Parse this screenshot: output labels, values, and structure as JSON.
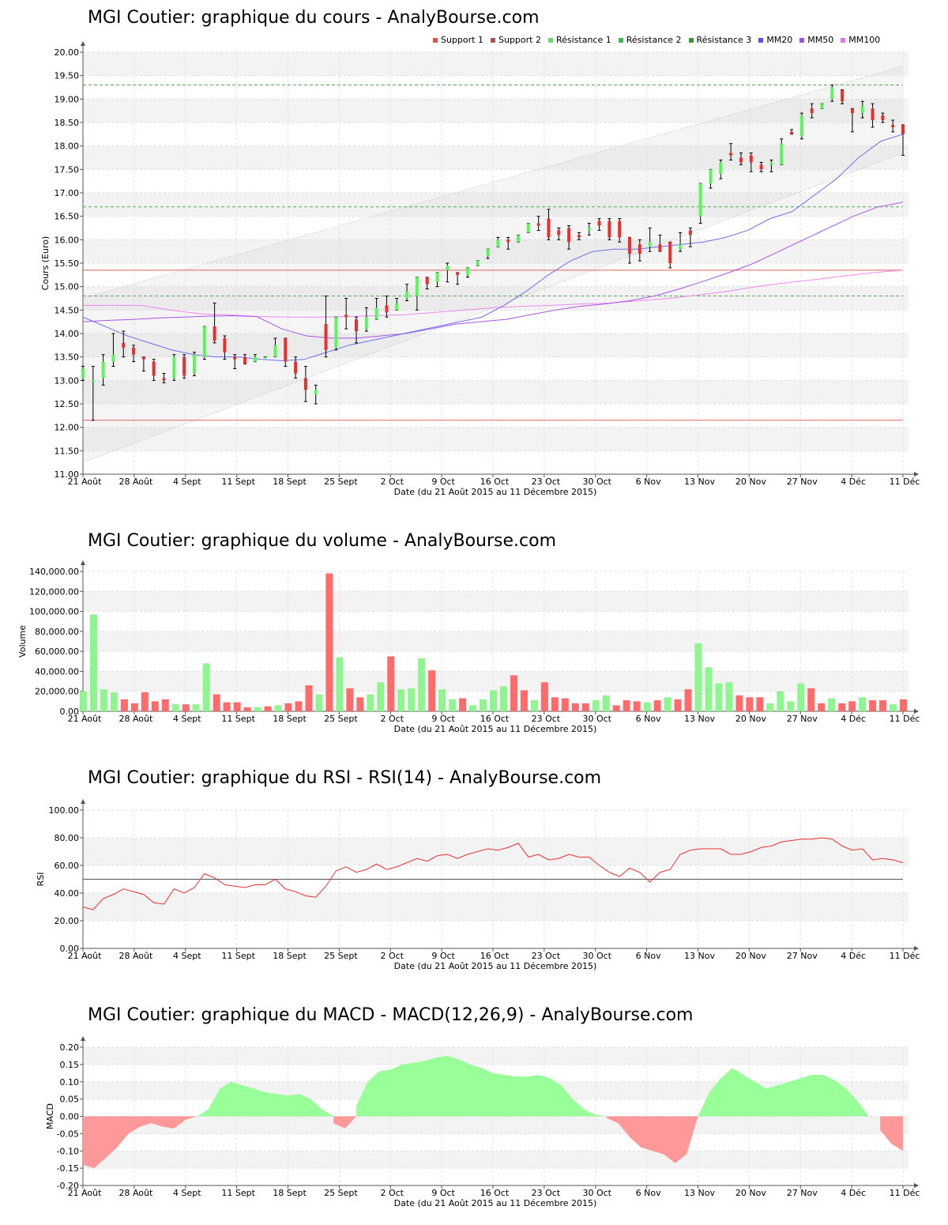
{
  "x_axis": {
    "ticks": [
      "21 Août",
      "28 Août",
      "4 Sept",
      "11 Sept",
      "18 Sept",
      "25 Sept",
      "2 Oct",
      "9 Oct",
      "16 Oct",
      "23 Oct",
      "30 Oct",
      "6 Nov",
      "13 Nov",
      "20 Nov",
      "27 Nov",
      "4 Déc",
      "11 Déc"
    ],
    "title": "Date (du 21 Août 2015 au 11 Décembre 2015)"
  },
  "colors": {
    "up": "#5df55d",
    "down": "#e8312f",
    "vol_up": "#8ff58f",
    "vol_down": "#ff6a6a",
    "mm20": "#6f6fef",
    "mm50": "#a855e8",
    "mm100": "#ee88ee",
    "support": "#e06060",
    "resistance": "#55aa55",
    "rsi": "#e83030",
    "macd_pos": "#99ff99",
    "macd_neg": "#ff9999"
  },
  "price_panel": {
    "title": "MGI Coutier: graphique du cours - AnalyBourse.com",
    "legend": [
      {
        "label": "Support 1",
        "color": "#e05050"
      },
      {
        "label": "Support 2",
        "color": "#b05050"
      },
      {
        "label": "Résistance 1",
        "color": "#66dd66"
      },
      {
        "label": "Résistance 2",
        "color": "#44bb44"
      },
      {
        "label": "Résistance 3",
        "color": "#339933"
      },
      {
        "label": "MM20",
        "color": "#5555ee"
      },
      {
        "label": "MM50",
        "color": "#9955dd"
      },
      {
        "label": "MM100",
        "color": "#dd77dd"
      }
    ],
    "chart_data": {
      "type": "candlestick",
      "title": "MGI Coutier: graphique du cours - AnalyBourse.com",
      "ylabel": "Cours (Euro)",
      "xlabel": "Date (du 21 Août 2015 au 11 Décembre 2015)",
      "ylim": [
        11.0,
        20.0
      ],
      "yticks": [
        "11.00",
        "11.50",
        "12.00",
        "12.50",
        "13.00",
        "13.50",
        "14.00",
        "14.50",
        "15.00",
        "15.50",
        "16.00",
        "16.50",
        "17.00",
        "17.50",
        "18.00",
        "18.50",
        "19.00",
        "19.50",
        "20.00"
      ],
      "candles": [
        [
          13.05,
          13.25,
          13.0,
          13.3
        ],
        [
          13.0,
          13.0,
          12.15,
          13.3
        ],
        [
          13.05,
          13.4,
          12.9,
          13.55
        ],
        [
          13.4,
          13.55,
          13.3,
          14.0
        ],
        [
          13.8,
          13.7,
          13.5,
          14.05
        ],
        [
          13.7,
          13.55,
          13.4,
          13.75
        ],
        [
          13.5,
          13.45,
          13.2,
          13.5
        ],
        [
          13.4,
          13.1,
          13.0,
          13.45
        ],
        [
          13.05,
          13.0,
          12.95,
          13.15
        ],
        [
          13.05,
          13.5,
          13.0,
          13.55
        ],
        [
          13.5,
          13.1,
          13.05,
          13.55
        ],
        [
          13.15,
          13.55,
          13.1,
          13.6
        ],
        [
          13.5,
          14.15,
          13.45,
          14.15
        ],
        [
          14.15,
          13.85,
          13.8,
          14.65
        ],
        [
          13.9,
          13.6,
          13.45,
          13.95
        ],
        [
          13.5,
          13.45,
          13.25,
          13.55
        ],
        [
          13.5,
          13.35,
          13.35,
          13.55
        ],
        [
          13.4,
          13.5,
          13.4,
          13.55
        ],
        [
          13.5,
          13.5,
          13.5,
          13.5
        ],
        [
          13.5,
          13.75,
          13.5,
          13.9
        ],
        [
          13.9,
          13.4,
          13.3,
          13.9
        ],
        [
          13.4,
          13.15,
          13.05,
          13.5
        ],
        [
          13.05,
          12.8,
          12.55,
          13.3
        ],
        [
          12.7,
          12.8,
          12.5,
          12.9
        ],
        [
          14.2,
          13.65,
          13.5,
          14.8
        ],
        [
          13.7,
          14.35,
          13.65,
          14.35
        ],
        [
          14.4,
          14.35,
          14.1,
          14.75
        ],
        [
          14.3,
          14.05,
          13.8,
          14.35
        ],
        [
          14.1,
          14.35,
          14.05,
          14.55
        ],
        [
          14.3,
          14.55,
          14.3,
          14.75
        ],
        [
          14.6,
          14.45,
          14.35,
          14.8
        ],
        [
          14.5,
          14.65,
          14.5,
          14.75
        ],
        [
          14.75,
          14.9,
          14.7,
          15.05
        ],
        [
          14.8,
          15.2,
          14.5,
          15.2
        ],
        [
          15.2,
          15.05,
          14.95,
          15.2
        ],
        [
          15.1,
          15.3,
          15.0,
          15.3
        ],
        [
          15.35,
          15.45,
          15.1,
          15.5
        ],
        [
          15.3,
          15.25,
          15.05,
          15.3
        ],
        [
          15.25,
          15.4,
          15.2,
          15.4
        ],
        [
          15.45,
          15.55,
          15.45,
          15.55
        ],
        [
          15.65,
          15.8,
          15.6,
          15.8
        ],
        [
          15.85,
          16.0,
          15.85,
          16.05
        ],
        [
          16.0,
          15.95,
          15.8,
          16.05
        ],
        [
          15.95,
          16.1,
          15.95,
          16.1
        ],
        [
          16.15,
          16.35,
          16.15,
          16.35
        ],
        [
          16.35,
          16.3,
          16.2,
          16.5
        ],
        [
          16.45,
          16.05,
          16.0,
          16.65
        ],
        [
          16.2,
          16.1,
          16.0,
          16.25
        ],
        [
          16.25,
          15.95,
          15.8,
          16.3
        ],
        [
          16.1,
          16.05,
          16.0,
          16.15
        ],
        [
          16.2,
          16.25,
          16.1,
          16.35
        ],
        [
          16.4,
          16.3,
          16.2,
          16.45
        ],
        [
          16.4,
          16.05,
          16.0,
          16.45
        ],
        [
          16.4,
          16.05,
          15.95,
          16.45
        ],
        [
          16.05,
          15.7,
          15.5,
          16.05
        ],
        [
          15.9,
          15.7,
          15.55,
          16.0
        ],
        [
          15.85,
          15.95,
          15.75,
          16.25
        ],
        [
          15.9,
          15.75,
          15.75,
          16.1
        ],
        [
          15.95,
          15.5,
          15.4,
          15.95
        ],
        [
          15.8,
          15.9,
          15.75,
          16.15
        ],
        [
          16.2,
          16.1,
          15.85,
          16.25
        ],
        [
          16.5,
          17.2,
          16.35,
          17.2
        ],
        [
          17.2,
          17.5,
          17.1,
          17.5
        ],
        [
          17.4,
          17.65,
          17.3,
          17.7
        ],
        [
          17.85,
          17.8,
          17.7,
          18.05
        ],
        [
          17.75,
          17.65,
          17.6,
          17.85
        ],
        [
          17.8,
          17.65,
          17.45,
          17.85
        ],
        [
          17.6,
          17.5,
          17.45,
          17.65
        ],
        [
          17.6,
          17.65,
          17.45,
          17.7
        ],
        [
          17.6,
          18.05,
          17.6,
          18.15
        ],
        [
          18.3,
          18.25,
          18.25,
          18.35
        ],
        [
          18.2,
          18.65,
          18.15,
          18.7
        ],
        [
          18.8,
          18.7,
          18.6,
          18.9
        ],
        [
          18.8,
          18.9,
          18.8,
          18.9
        ],
        [
          19.0,
          19.25,
          18.95,
          19.3
        ],
        [
          19.2,
          18.95,
          18.9,
          19.2
        ],
        [
          18.8,
          18.7,
          18.3,
          18.8
        ],
        [
          18.7,
          18.85,
          18.6,
          18.95
        ],
        [
          18.8,
          18.55,
          18.4,
          18.9
        ],
        [
          18.65,
          18.55,
          18.5,
          18.7
        ],
        [
          18.45,
          18.4,
          18.3,
          18.55
        ],
        [
          18.45,
          18.25,
          17.8,
          18.45
        ]
      ],
      "support_lines": [
        15.35,
        12.15
      ],
      "resistance_lines": [
        14.8,
        16.7,
        19.3
      ],
      "channel_upper": [
        14.75,
        19.7
      ],
      "channel_lower": [
        11.25,
        17.85
      ],
      "mm20": [
        14.35,
        14.15,
        13.95,
        13.8,
        13.65,
        13.55,
        13.5,
        13.5,
        13.45,
        13.42,
        13.45,
        13.6,
        13.75,
        13.85,
        13.95,
        14.05,
        14.15,
        14.25,
        14.35,
        14.6,
        14.9,
        15.25,
        15.55,
        15.75,
        15.8,
        15.8,
        15.85,
        15.9,
        15.95,
        16.05,
        16.2,
        16.45,
        16.6,
        16.95,
        17.3,
        17.75,
        18.1,
        18.25
      ],
      "mm50": [
        14.25,
        14.28,
        14.3,
        14.33,
        14.35,
        14.37,
        14.38,
        14.36,
        14.1,
        13.95,
        13.9,
        13.9,
        13.95,
        14.0,
        14.1,
        14.2,
        14.25,
        14.3,
        14.4,
        14.5,
        14.58,
        14.63,
        14.7,
        14.8,
        14.95,
        15.12,
        15.3,
        15.5,
        15.75,
        16.0,
        16.25,
        16.5,
        16.7,
        16.8
      ],
      "mm100": [
        14.6,
        14.6,
        14.6,
        14.5,
        14.42,
        14.4,
        14.36,
        14.35,
        14.35,
        14.36,
        14.38,
        14.4,
        14.45,
        14.5,
        14.55,
        14.58,
        14.6,
        14.63,
        14.65,
        14.7,
        14.75,
        14.82,
        14.9,
        15.0,
        15.08,
        15.15,
        15.23,
        15.3,
        15.35
      ]
    }
  },
  "volume_panel": {
    "title": "MGI Coutier: graphique du volume - AnalyBourse.com",
    "chart_data": {
      "type": "bar",
      "title": "MGI Coutier: graphique du volume - AnalyBourse.com",
      "ylabel": "Volume",
      "xlabel": "Date (du 21 Août 2015 au 11 Décembre 2015)",
      "ylim": [
        0,
        140000
      ],
      "yticks": [
        "0.00",
        "20,000.00",
        "40,000.00",
        "60,000.00",
        "80,000.00",
        "100,000.00",
        "120,000.00",
        "140,000.00"
      ],
      "values": [
        20000,
        97000,
        22000,
        19000,
        12000,
        8000,
        19000,
        10000,
        12000,
        7000,
        7000,
        7000,
        48000,
        17000,
        9000,
        9000,
        4000,
        4000,
        5000,
        6000,
        8000,
        10000,
        26000,
        17000,
        138000,
        54000,
        23000,
        14000,
        17000,
        29000,
        55000,
        22000,
        23000,
        53000,
        41000,
        22000,
        12000,
        13000,
        6000,
        12000,
        21000,
        25000,
        36000,
        21000,
        11000,
        29000,
        14000,
        13000,
        8000,
        8000,
        11000,
        16000,
        6000,
        11000,
        10000,
        9000,
        11000,
        14000,
        12000,
        22000,
        68000,
        44000,
        28000,
        29000,
        16000,
        14000,
        14000,
        8000,
        20000,
        10000,
        28000,
        23000,
        8000,
        13000,
        8000,
        10000,
        14000,
        11000,
        11000,
        7000,
        12000
      ],
      "up": [
        true,
        true,
        true,
        true,
        false,
        false,
        false,
        false,
        false,
        true,
        false,
        true,
        true,
        false,
        false,
        false,
        false,
        true,
        false,
        true,
        false,
        false,
        false,
        true,
        false,
        true,
        false,
        false,
        true,
        true,
        false,
        true,
        true,
        true,
        false,
        true,
        true,
        false,
        true,
        true,
        true,
        true,
        false,
        false,
        true,
        false,
        false,
        false,
        false,
        false,
        true,
        true,
        false,
        false,
        false,
        true,
        false,
        true,
        false,
        false,
        true,
        true,
        true,
        true,
        false,
        false,
        false,
        true,
        true,
        true,
        true,
        false,
        false,
        true,
        false,
        false,
        true,
        false,
        false,
        true,
        false
      ]
    }
  },
  "rsi_panel": {
    "title": "MGI Coutier: graphique du RSI - RSI(14) - AnalyBourse.com",
    "chart_data": {
      "type": "line",
      "title": "MGI Coutier: graphique du RSI - RSI(14) - AnalyBourse.com",
      "ylabel": "RSI",
      "xlabel": "Date (du 21 Août 2015 au 11 Décembre 2015)",
      "ylim": [
        0,
        100
      ],
      "yticks": [
        "0.00",
        "20.00",
        "40.00",
        "60.00",
        "80.00",
        "100.00"
      ],
      "reference_line": 50,
      "values": [
        30,
        28,
        36,
        39,
        43,
        41,
        39,
        33,
        32,
        43,
        40,
        44,
        54,
        51,
        46,
        45,
        44,
        46,
        46,
        50,
        43,
        41,
        38,
        37,
        45,
        56,
        59,
        55,
        57,
        61,
        57,
        59,
        62,
        65,
        63,
        67,
        68,
        65,
        68,
        70,
        72,
        71,
        73,
        76,
        66,
        68,
        64,
        65,
        68,
        66,
        66,
        60,
        55,
        52,
        58,
        55,
        48,
        55,
        57,
        68,
        71,
        72,
        72,
        72,
        68,
        68,
        70,
        73,
        74,
        77,
        78,
        79,
        79,
        80,
        79,
        74,
        71,
        72,
        64,
        65,
        64,
        62
      ]
    }
  },
  "macd_panel": {
    "title": "MGI Coutier: graphique du MACD - MACD(12,26,9) - AnalyBourse.com",
    "chart_data": {
      "type": "area",
      "title": "MGI Coutier: graphique du MACD - MACD(12,26,9) - AnalyBourse.com",
      "ylabel": "MACD",
      "xlabel": "Date (du 21 Août 2015 au 11 Décembre 2015)",
      "ylim": [
        -0.2,
        0.2
      ],
      "yticks": [
        "-0.20",
        "-0.15",
        "-0.10",
        "-0.05",
        "0.00",
        "0.05",
        "0.10",
        "0.15",
        "0.20"
      ],
      "values": [
        -0.14,
        -0.15,
        -0.12,
        -0.09,
        -0.05,
        -0.03,
        -0.02,
        -0.03,
        -0.035,
        -0.01,
        0.0,
        0.02,
        0.08,
        0.1,
        0.09,
        0.08,
        0.07,
        0.065,
        0.06,
        0.065,
        0.05,
        0.02,
        -0.02,
        -0.035,
        0.03,
        0.1,
        0.13,
        0.135,
        0.15,
        0.155,
        0.16,
        0.17,
        0.175,
        0.165,
        0.15,
        0.14,
        0.125,
        0.12,
        0.115,
        0.115,
        0.12,
        0.11,
        0.09,
        0.05,
        0.02,
        0.005,
        -0.005,
        -0.02,
        -0.06,
        -0.09,
        -0.1,
        -0.11,
        -0.135,
        -0.11,
        0.0,
        0.07,
        0.11,
        0.14,
        0.12,
        0.1,
        0.08,
        0.09,
        0.1,
        0.11,
        0.12,
        0.12,
        0.105,
        0.08,
        0.045,
        0.0,
        -0.04,
        -0.08,
        -0.1
      ]
    }
  }
}
